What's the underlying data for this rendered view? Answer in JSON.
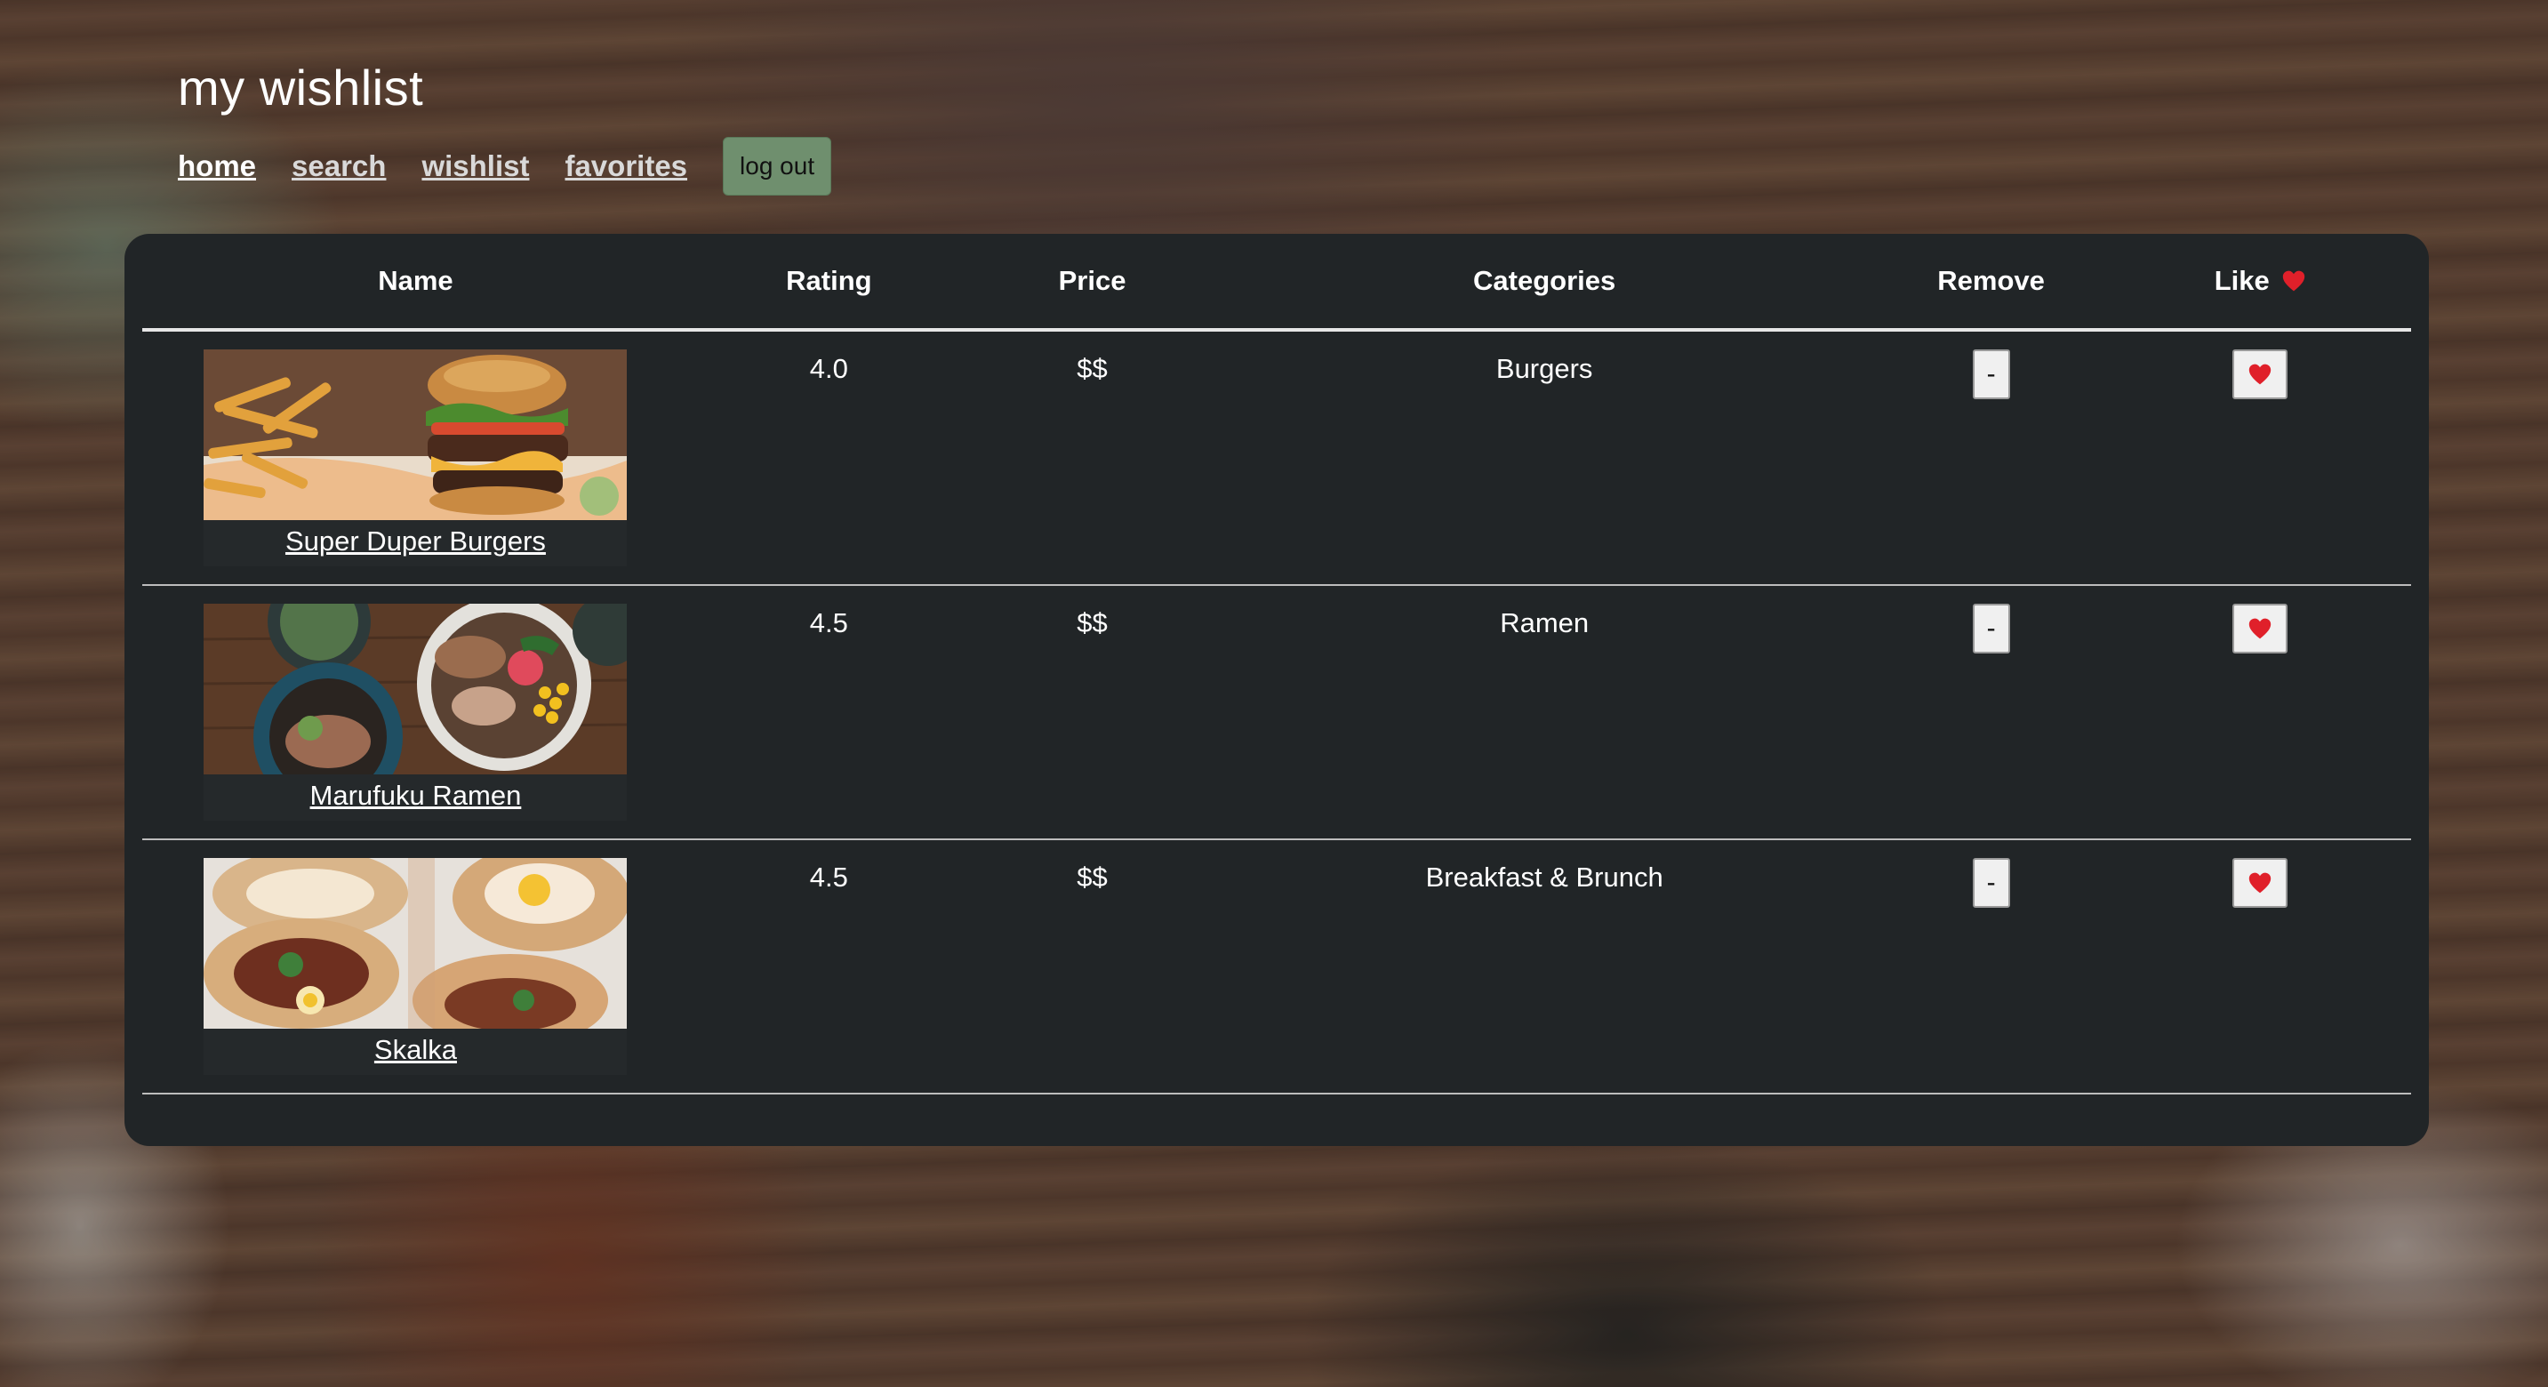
{
  "header": {
    "title": "my wishlist"
  },
  "nav": {
    "items": [
      {
        "label": "home",
        "active": true
      },
      {
        "label": "search",
        "active": false
      },
      {
        "label": "wishlist",
        "active": false
      },
      {
        "label": "favorites",
        "active": false
      }
    ],
    "logout_label": "log out"
  },
  "table": {
    "columns": {
      "name": "Name",
      "rating": "Rating",
      "price": "Price",
      "categories": "Categories",
      "remove": "Remove",
      "like": "Like"
    },
    "like_icon": "heart-icon",
    "rows": [
      {
        "name": "Super Duper Burgers",
        "rating": "4.0",
        "price": "$$",
        "categories": "Burgers",
        "remove_label": "-",
        "image": "burger-and-fries-photo"
      },
      {
        "name": "Marufuku Ramen",
        "rating": "4.5",
        "price": "$$",
        "categories": "Ramen",
        "remove_label": "-",
        "image": "ramen-bowls-photo"
      },
      {
        "name": "Skalka",
        "rating": "4.5",
        "price": "$$",
        "categories": "Breakfast & Brunch",
        "remove_label": "-",
        "image": "khachapuri-bread-boats-photo"
      }
    ]
  },
  "colors": {
    "panel_bg": "#212527",
    "logout_bg": "#6f8f6e",
    "heart": "#e0202a"
  }
}
